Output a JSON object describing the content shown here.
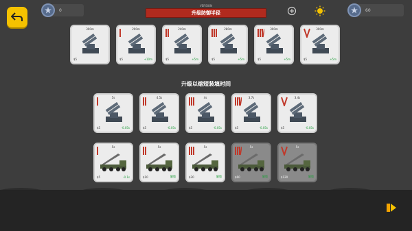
{
  "header": {
    "coins": "0",
    "gems": "60",
    "version": "VERSION",
    "title": "升级防御半径"
  },
  "sections": {
    "reload_title": "升级以缩短装填时间"
  },
  "radius_cards": [
    {
      "value": "300m",
      "price": "$5",
      "bonus": "",
      "level": 0
    },
    {
      "value": "200m",
      "price": "$5",
      "bonus": "+10m",
      "level": 1
    },
    {
      "value": "240m",
      "price": "$5",
      "bonus": "+5m",
      "level": 2
    },
    {
      "value": "280m",
      "price": "$5",
      "bonus": "+5m",
      "level": 3
    },
    {
      "value": "300m",
      "price": "$5",
      "bonus": "+5m",
      "level": 4
    },
    {
      "value": "300m",
      "price": "$5",
      "bonus": "+5m",
      "level": 5
    }
  ],
  "reload_cards": [
    {
      "value": "5s",
      "price": "$5",
      "bonus": "-0.05s",
      "level": 1
    },
    {
      "value": "4.5s",
      "price": "$5",
      "bonus": "-0.05s",
      "level": 2
    },
    {
      "value": "4s",
      "price": "$5",
      "bonus": "-0.05s",
      "level": 3
    },
    {
      "value": "3.7s",
      "price": "$5",
      "bonus": "-0.05s",
      "level": 4
    },
    {
      "value": "3.4s",
      "price": "$5",
      "bonus": "-0.05s",
      "level": 5
    }
  ],
  "truck_cards": [
    {
      "value": "5s",
      "price": "$5",
      "bonus": "-0.1s",
      "level": 1,
      "locked": false
    },
    {
      "value": "5s",
      "price": "$10",
      "bonus": "解锁",
      "level": 2,
      "locked": false
    },
    {
      "value": "5s",
      "price": "$30",
      "bonus": "解锁",
      "level": 3,
      "locked": false
    },
    {
      "value": "5s",
      "price": "$60",
      "bonus": "解锁",
      "level": 4,
      "locked": true
    },
    {
      "value": "5s",
      "price": "$120",
      "bonus": "解锁",
      "level": 5,
      "locked": true
    }
  ],
  "icons": {
    "back": "back-arrow-icon",
    "coin": "star-icon",
    "crosshair": "crosshair-icon",
    "sun": "sun-icon",
    "gem": "star-icon",
    "play": "play-icon"
  },
  "colors": {
    "accent": "#f5c200",
    "title_bar": "#b02a1e",
    "bonus": "#1f9e3a",
    "level_badge": "#c0392b"
  }
}
